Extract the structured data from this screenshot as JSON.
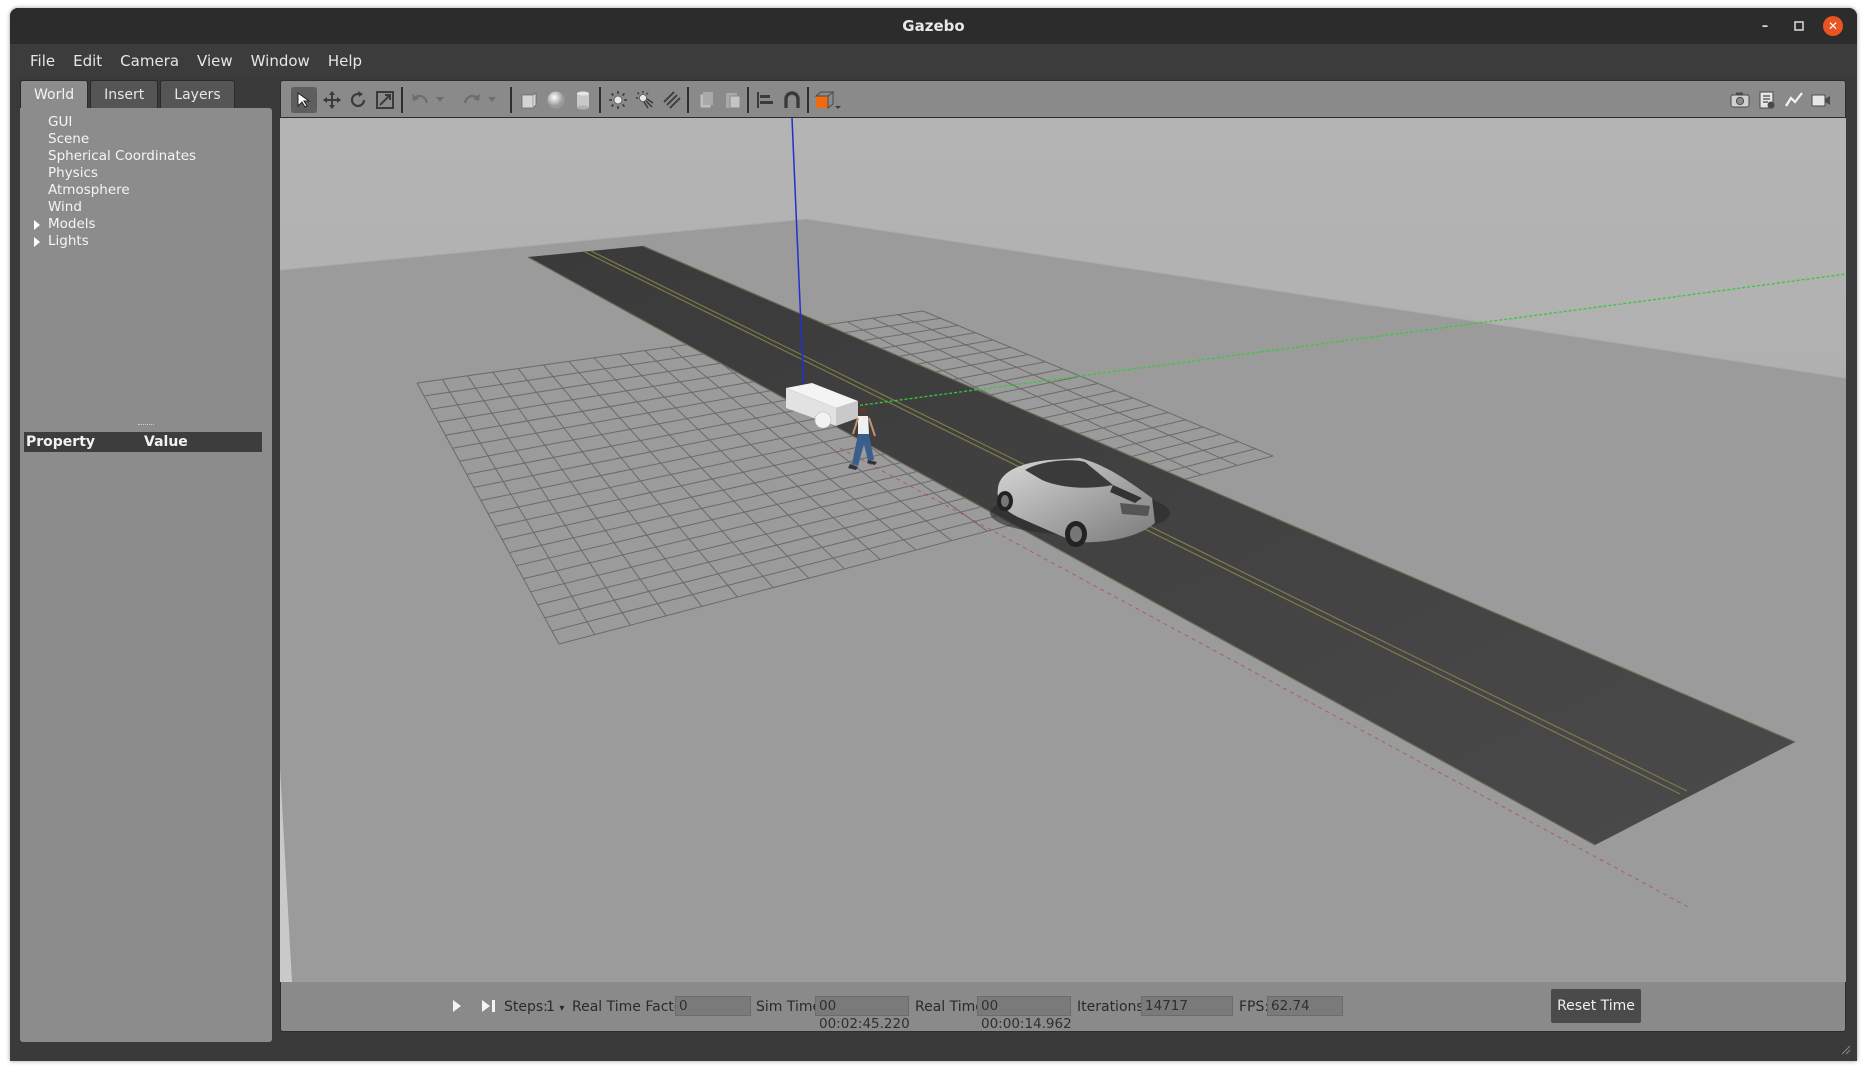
{
  "window": {
    "title": "Gazebo"
  },
  "menu": [
    "File",
    "Edit",
    "Camera",
    "View",
    "Window",
    "Help"
  ],
  "left_panel": {
    "tabs": [
      "World",
      "Insert",
      "Layers"
    ],
    "active_tab": "World",
    "tree": [
      {
        "label": "GUI",
        "expandable": false
      },
      {
        "label": "Scene",
        "expandable": false
      },
      {
        "label": "Spherical Coordinates",
        "expandable": false
      },
      {
        "label": "Physics",
        "expandable": false
      },
      {
        "label": "Atmosphere",
        "expandable": false
      },
      {
        "label": "Wind",
        "expandable": false
      },
      {
        "label": "Models",
        "expandable": true
      },
      {
        "label": "Lights",
        "expandable": true
      }
    ],
    "property_header": {
      "property": "Property",
      "value": "Value"
    }
  },
  "toolbar": {
    "left_icons": [
      "select-mode-icon",
      "translate-mode-icon",
      "rotate-mode-icon",
      "scale-mode-icon",
      "undo-icon",
      "undo-history-icon",
      "redo-icon",
      "redo-history-icon",
      "box-shape-icon",
      "sphere-shape-icon",
      "cylinder-shape-icon",
      "point-light-icon",
      "spot-light-icon",
      "directional-light-icon",
      "copy-icon",
      "paste-icon",
      "align-icon",
      "snap-icon",
      "view-angle-icon"
    ],
    "right_icons": [
      "screenshot-icon",
      "log-icon",
      "plot-icon",
      "record-video-icon"
    ],
    "accent_color": "#f06a14"
  },
  "bottom_bar": {
    "steps_label": "Steps:",
    "steps_value": "1",
    "rtf_label": "Real Time Factor:",
    "rtf_value": "0",
    "sim_time_label": "Sim Time:",
    "sim_time_value": "00 00:02:45.220",
    "real_time_label": "Real Time:",
    "real_time_value": "00 00:00:14.962",
    "iterations_label": "Iterations:",
    "iterations_value": "14717",
    "fps_label": "FPS:",
    "fps_value": "62.74",
    "reset_button": "Reset Time"
  }
}
